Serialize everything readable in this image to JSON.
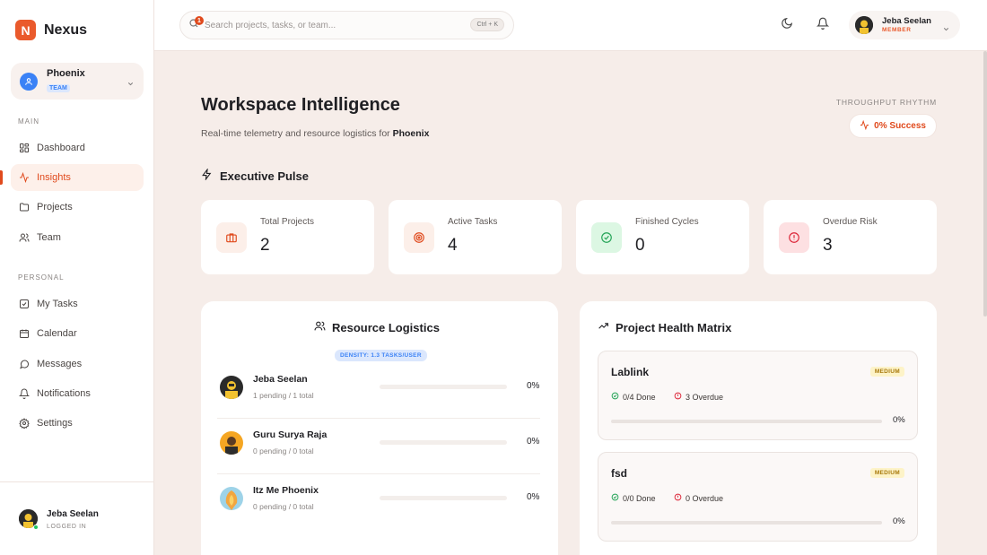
{
  "brand": {
    "logo_letter": "N",
    "name": "Nexus",
    "accent": "#ea5a2c"
  },
  "team": {
    "name": "Phoenix",
    "tag": "TEAM"
  },
  "nav": {
    "main_label": "MAIN",
    "main_items": [
      {
        "label": "Dashboard",
        "icon": "grid-icon"
      },
      {
        "label": "Insights",
        "icon": "activity-icon",
        "active": true
      },
      {
        "label": "Projects",
        "icon": "folder-icon"
      },
      {
        "label": "Team",
        "icon": "users-icon"
      }
    ],
    "personal_label": "PERSONAL",
    "personal_items": [
      {
        "label": "My Tasks",
        "icon": "check-square-icon"
      },
      {
        "label": "Calendar",
        "icon": "calendar-icon"
      },
      {
        "label": "Messages",
        "icon": "message-icon"
      },
      {
        "label": "Notifications",
        "icon": "bell-icon"
      },
      {
        "label": "Settings",
        "icon": "gear-icon"
      }
    ]
  },
  "sidebar_user": {
    "name": "Jeba Seelan",
    "status": "LOGGED IN"
  },
  "topbar": {
    "search_placeholder": "Search projects, tasks, or team...",
    "shortcut": "Ctrl + K",
    "notification_count": "1",
    "user_name": "Jeba Seelan",
    "user_role": "MEMBER"
  },
  "page": {
    "title": "Workspace Intelligence",
    "subtitle_prefix": "Real-time telemetry and resource logistics for",
    "subtitle_team": "Phoenix",
    "rhythm_label": "THROUGHPUT RHYTHM",
    "success_label": "0% Success"
  },
  "pulse": {
    "title": "Executive Pulse",
    "stats": [
      {
        "label": "Total Projects",
        "value": "2",
        "icon": "briefcase-icon"
      },
      {
        "label": "Active Tasks",
        "value": "4",
        "icon": "target-icon"
      },
      {
        "label": "Finished Cycles",
        "value": "0",
        "icon": "check-circle-icon"
      },
      {
        "label": "Overdue Risk",
        "value": "3",
        "icon": "alert-circle-icon"
      }
    ]
  },
  "logistics": {
    "title": "Resource Logistics",
    "density": "DENSITY: 1.3 TASKS/USER",
    "members": [
      {
        "name": "Jeba Seelan",
        "sub": "1 pending / 1 total",
        "pct": "0%",
        "progress": 0
      },
      {
        "name": "Guru Surya Raja",
        "sub": "0 pending / 0 total",
        "pct": "0%",
        "progress": 0
      },
      {
        "name": "Itz Me Phoenix",
        "sub": "0 pending / 0 total",
        "pct": "0%",
        "progress": 0
      }
    ]
  },
  "health": {
    "title": "Project Health Matrix",
    "projects": [
      {
        "name": "Lablink",
        "priority": "MEDIUM",
        "done": "0/4 Done",
        "overdue": "3 Overdue",
        "pct": "0%",
        "progress": 0
      },
      {
        "name": "fsd",
        "priority": "MEDIUM",
        "done": "0/0 Done",
        "overdue": "0 Overdue",
        "pct": "0%",
        "progress": 0
      }
    ]
  }
}
